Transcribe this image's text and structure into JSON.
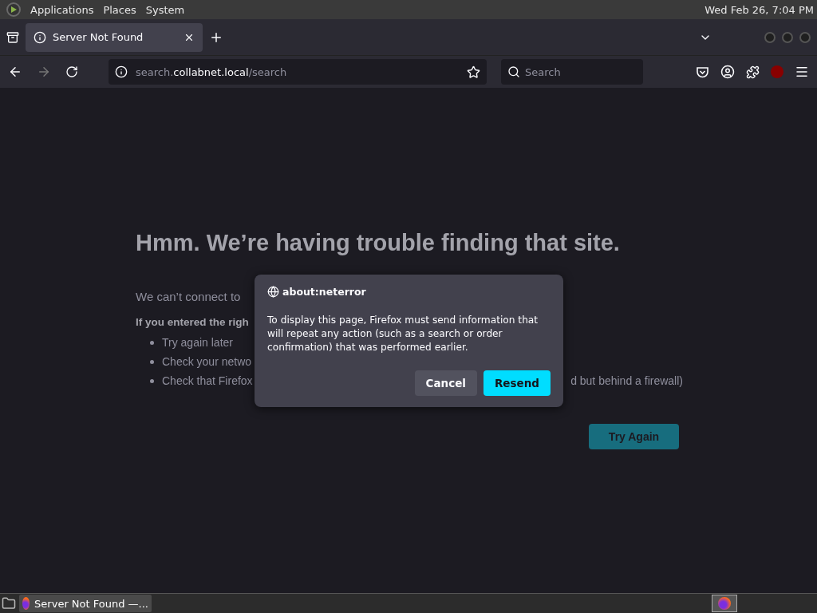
{
  "top_panel": {
    "menus": [
      "Applications",
      "Places",
      "System"
    ],
    "clock": "Wed Feb 26, 7:04 PM"
  },
  "tabs": [
    {
      "label": "Server Not Found",
      "selected": true
    }
  ],
  "nav": {
    "url": {
      "prefix": "search.",
      "domain": "collabnet.local",
      "path": "/search"
    },
    "search": {
      "placeholder": "Search"
    }
  },
  "page": {
    "heading": "Hmm. We’re having trouble finding that site.",
    "intro": "We can’t connect to",
    "subheading": "If you entered the righ",
    "bullets": [
      {
        "text": "Try again later"
      },
      {
        "text": "Check your netwo"
      },
      {
        "text": "Check that Firefox",
        "tail": "d but behind a firewall)"
      }
    ],
    "button": "Try Again"
  },
  "dialog": {
    "title": "about:neterror",
    "message": "To display this page, Firefox must send information that will repeat any action (such as a search or order confirmation) that was performed earlier.",
    "buttons": [
      {
        "label": "Cancel",
        "kind": "secondary"
      },
      {
        "label": "Resend",
        "kind": "primary"
      }
    ]
  },
  "taskbar": {
    "tasks": [
      {
        "label": "Server Not Found —..."
      }
    ]
  }
}
